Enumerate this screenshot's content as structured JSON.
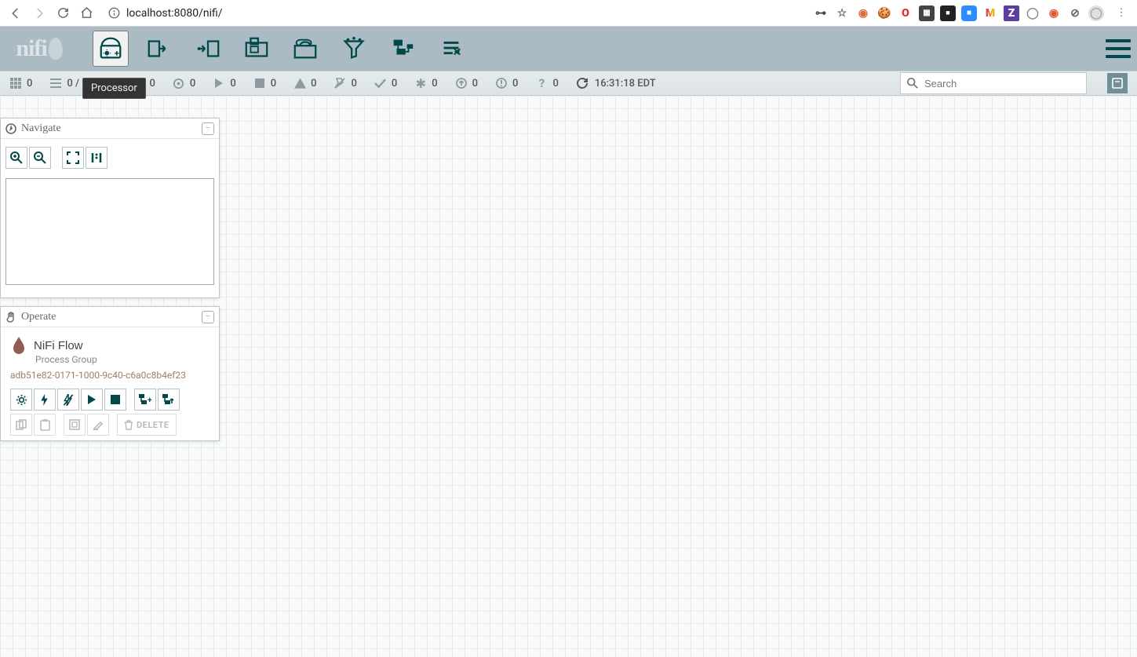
{
  "browser": {
    "url": "localhost:8080/nifi/"
  },
  "tooltip": "Processor",
  "status": {
    "clustered": "0",
    "queued": "0 / 0 bytes",
    "transmitting_off": "0",
    "transmitting_on": "0",
    "running": "0",
    "stopped": "0",
    "invalid": "0",
    "disabled": "0",
    "up_to_date": "0",
    "locally_modified": "0",
    "stale": "0",
    "sync_failure": "0",
    "unknown": "0",
    "refreshed": "16:31:18 EDT"
  },
  "search": {
    "placeholder": "Search"
  },
  "navigate": {
    "title": "Navigate"
  },
  "operate": {
    "title": "Operate",
    "flow_name": "NiFi Flow",
    "flow_type": "Process Group",
    "flow_id": "adb51e82-0171-1000-9c40-c6a0c8b4ef23",
    "delete_label": "DELETE"
  }
}
